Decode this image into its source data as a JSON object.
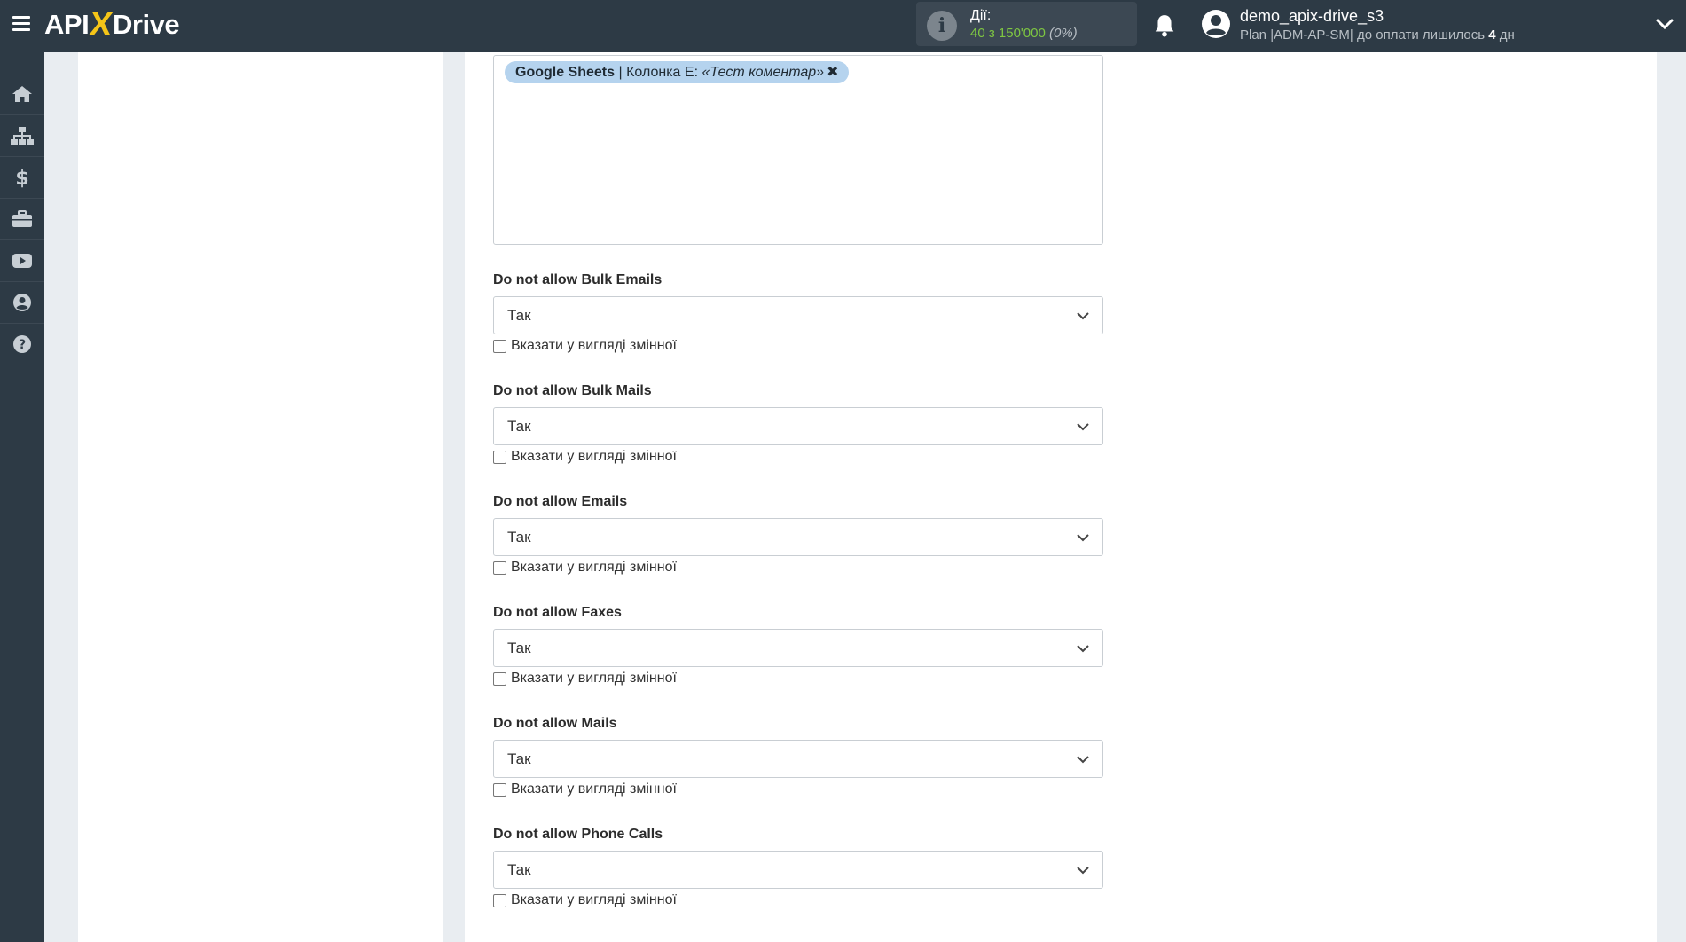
{
  "header": {
    "logo_pre": "API",
    "logo_x": "X",
    "logo_post": "Drive",
    "actions_label": "Дії:",
    "actions_value": "40 з 150'000",
    "actions_percent": "(0%)",
    "user_name": "demo_apix-drive_s3",
    "plan_text": "Plan |ADM-AP-SM| до оплати лишилось",
    "plan_days": "4",
    "plan_days_unit": "дн"
  },
  "sidebar": {
    "items": [
      {
        "icon": "home-icon"
      },
      {
        "icon": "sitemap-icon"
      },
      {
        "icon": "dollar-icon"
      },
      {
        "icon": "briefcase-icon"
      },
      {
        "icon": "youtube-icon"
      },
      {
        "icon": "user-circle-icon"
      },
      {
        "icon": "question-icon"
      }
    ]
  },
  "textarea": {
    "tag_source": "Google Sheets",
    "tag_sep": " | Колонка E: ",
    "tag_value": "«Тест коментар»",
    "tag_remove": "✖"
  },
  "fields": [
    {
      "label": "Do not allow Bulk Emails",
      "value": "Так",
      "checkbox_label": "Вказати у вигляді змінної"
    },
    {
      "label": "Do not allow Bulk Mails",
      "value": "Так",
      "checkbox_label": "Вказати у вигляді змінної"
    },
    {
      "label": "Do not allow Emails",
      "value": "Так",
      "checkbox_label": "Вказати у вигляді змінної"
    },
    {
      "label": "Do not allow Faxes",
      "value": "Так",
      "checkbox_label": "Вказати у вигляді змінної"
    },
    {
      "label": "Do not allow Mails",
      "value": "Так",
      "checkbox_label": "Вказати у вигляді змінної"
    },
    {
      "label": "Do not allow Phone Calls",
      "value": "Так",
      "checkbox_label": "Вказати у вигляді змінної"
    }
  ]
}
